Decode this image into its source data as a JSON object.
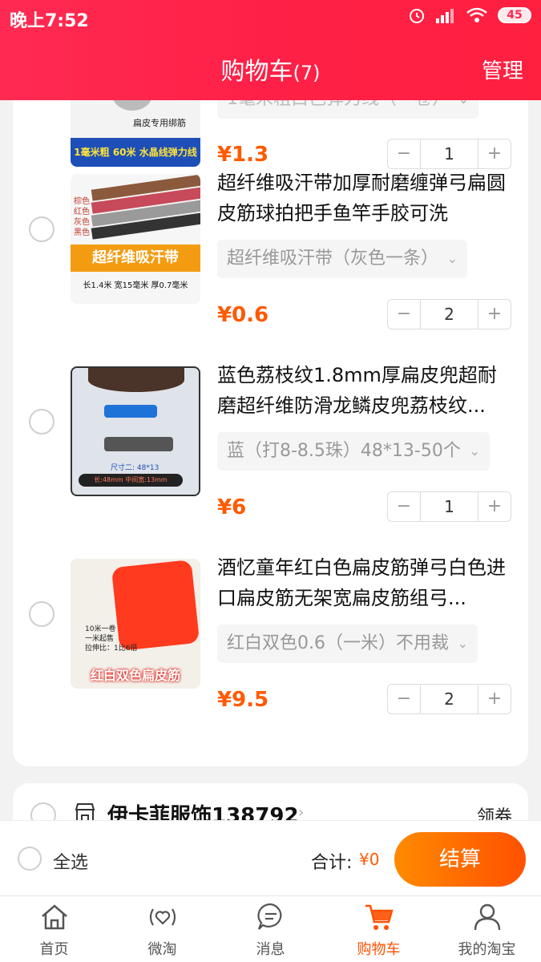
{
  "status": {
    "time": "晚上7:52",
    "battery": "45"
  },
  "header": {
    "title": "购物车",
    "count": "(7)",
    "manage": "管理"
  },
  "first_item_partial": {
    "price": "¥1.3",
    "qty": "1",
    "sku_text": "1毫米粗白色弹力线（一卷）",
    "thumb_caption_1": "扁皮专用绑筋",
    "thumb_caption_2": "1毫米粗 60米 水晶线弹力线"
  },
  "items": [
    {
      "title": "超纤维吸汗带加厚耐磨缠弹弓扁圆皮筋球拍把手鱼竿手胶可洗",
      "sku": "超纤维吸汗带（灰色一条）",
      "price": "¥0.6",
      "qty": "2",
      "thumb": {
        "colors_label": [
          "棕色",
          "红色",
          "灰色",
          "黑色"
        ],
        "banner": "超纤维吸汗带",
        "spec": "长1.4米 宽15毫米 厚0.7毫米"
      }
    },
    {
      "title": "蓝色荔枝纹1.8mm厚扁皮兜超耐磨超纤维防滑龙鳞皮兜荔枝纹...",
      "sku": "蓝（打8-8.5珠）48*13-50个",
      "price": "¥6",
      "qty": "1",
      "thumb": {
        "size_text": "尺寸二: 48*13",
        "bottom_text": "长:48mm 中间宽:13mm"
      }
    },
    {
      "title": "酒忆童年红白色扁皮筋弹弓白色进口扁皮筋无架宽扁皮筋组弓...",
      "sku": "红白双色0.6（一米）不用裁",
      "price": "¥9.5",
      "qty": "2",
      "thumb": {
        "line1": "10米一卷",
        "line2": "一米起售",
        "line3": "拉伸比：1比6倍",
        "banner": "红白双色扁皮筋"
      }
    }
  ],
  "next_store": {
    "name": "伊卡菲服饰138792",
    "coupon": "领券"
  },
  "checkout": {
    "select_all": "全选",
    "total_label": "合计:",
    "total_value": "¥0",
    "settle": "结算"
  },
  "tabs": [
    {
      "label": "首页",
      "icon": "home-icon"
    },
    {
      "label": "微淘",
      "icon": "heart-signal-icon"
    },
    {
      "label": "消息",
      "icon": "message-icon"
    },
    {
      "label": "购物车",
      "icon": "cart-icon",
      "active": true
    },
    {
      "label": "我的淘宝",
      "icon": "user-icon"
    }
  ],
  "colors": {
    "header": "#ff2047",
    "price": "#ff5a00",
    "settle_start": "#ff8a00",
    "settle_end": "#ff5000"
  }
}
